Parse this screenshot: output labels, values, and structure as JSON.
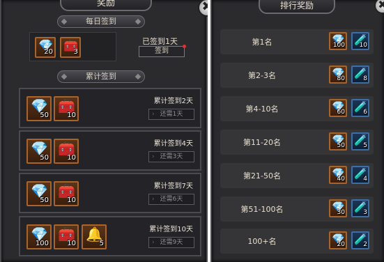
{
  "left": {
    "title": "奖励",
    "daily_header": "每日签到",
    "daily_items": [
      {
        "icon": "gem-icon",
        "glyph": "💎",
        "count": "20"
      },
      {
        "icon": "chest-icon",
        "glyph": "🧰",
        "count": "3"
      }
    ],
    "signed_status": "已签到1天",
    "sign_button": "签到",
    "cumulative_header": "累计签到",
    "cumulative_rows": [
      {
        "label": "累计签到2天",
        "need": "还需1天",
        "items": [
          {
            "icon": "gem-icon",
            "glyph": "💎",
            "count": "50"
          },
          {
            "icon": "chest-icon",
            "glyph": "🧰",
            "count": "10"
          }
        ]
      },
      {
        "label": "累计签到4天",
        "need": "还需3天",
        "items": [
          {
            "icon": "gem-icon",
            "glyph": "💎",
            "count": "50"
          },
          {
            "icon": "chest-icon",
            "glyph": "🧰",
            "count": "10"
          }
        ]
      },
      {
        "label": "累计签到7天",
        "need": "还需6天",
        "items": [
          {
            "icon": "gem-icon",
            "glyph": "💎",
            "count": "50"
          },
          {
            "icon": "chest-icon",
            "glyph": "🧰",
            "count": "10"
          }
        ]
      },
      {
        "label": "累计签到10天",
        "need": "还需9天",
        "items": [
          {
            "icon": "gem-icon",
            "glyph": "💎",
            "count": "100"
          },
          {
            "icon": "chest-icon",
            "glyph": "🧰",
            "count": "10"
          },
          {
            "icon": "bell-icon",
            "glyph": "🔔",
            "count": "5"
          }
        ]
      }
    ]
  },
  "right": {
    "title": "排行奖励",
    "ranks": [
      {
        "name": "第1名",
        "gem": "100",
        "potion": "10"
      },
      {
        "name": "第2-3名",
        "gem": "80",
        "potion": "8"
      },
      {
        "name": "第4-10名",
        "gem": "60",
        "potion": "6"
      },
      {
        "name": "第11-20名",
        "gem": "50",
        "potion": "5"
      },
      {
        "name": "第21-50名",
        "gem": "40",
        "potion": "4"
      },
      {
        "name": "第51-100名",
        "gem": "30",
        "potion": "3"
      },
      {
        "name": "100+名",
        "gem": "20",
        "potion": "2"
      }
    ]
  },
  "icons": {
    "gem": "💎",
    "chest": "🧰",
    "bell": "🔔",
    "potion": "🧪",
    "close": "✖"
  },
  "colors": {
    "slot_border": "#a8642a",
    "panel_bg": "#2b2b2e",
    "row_bg": "#353538",
    "potion_slot_border": "#3c6ea8"
  }
}
